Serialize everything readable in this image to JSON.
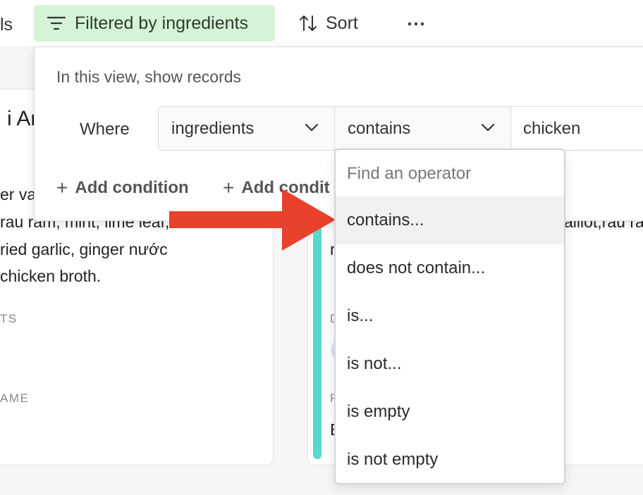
{
  "toolbar": {
    "fields_fragment": "ls",
    "filter_label": "Filtered by ingredients",
    "sort_label": "Sort",
    "more_label": "···",
    "filter_bg_color": "#d5f3d6"
  },
  "background_cards": {
    "left": {
      "title_fragment": "i An",
      "lines": [
        "er va",
        "rau ram, mint, lime leaf,",
        "ried garlic, ginger nước",
        "chicken broth."
      ],
      "label_1": "TS",
      "label_2": "AME"
    },
    "right": {
      "text_fragment_1": "alliot,rau ra",
      "text_fragment_2": "r",
      "label_1": "D",
      "label_2": "R",
      "text_fragment_3": "B",
      "accent_color": "#5ed5cd"
    }
  },
  "filter_popover": {
    "heading": "In this view, show records",
    "where_label": "Where",
    "field_select": "ingredients",
    "operator_select": "contains",
    "value_input": "chicken",
    "add_condition_label": "Add condition",
    "add_condition_group_fragment": "Add condit"
  },
  "operator_dropdown": {
    "search_placeholder": "Find an operator",
    "options": [
      "contains...",
      "does not contain...",
      "is...",
      "is not...",
      "is empty",
      "is not empty"
    ],
    "highlighted_option": "contains..."
  },
  "annotation": {
    "arrow_color": "#e8412c",
    "points_to": "contains..."
  }
}
